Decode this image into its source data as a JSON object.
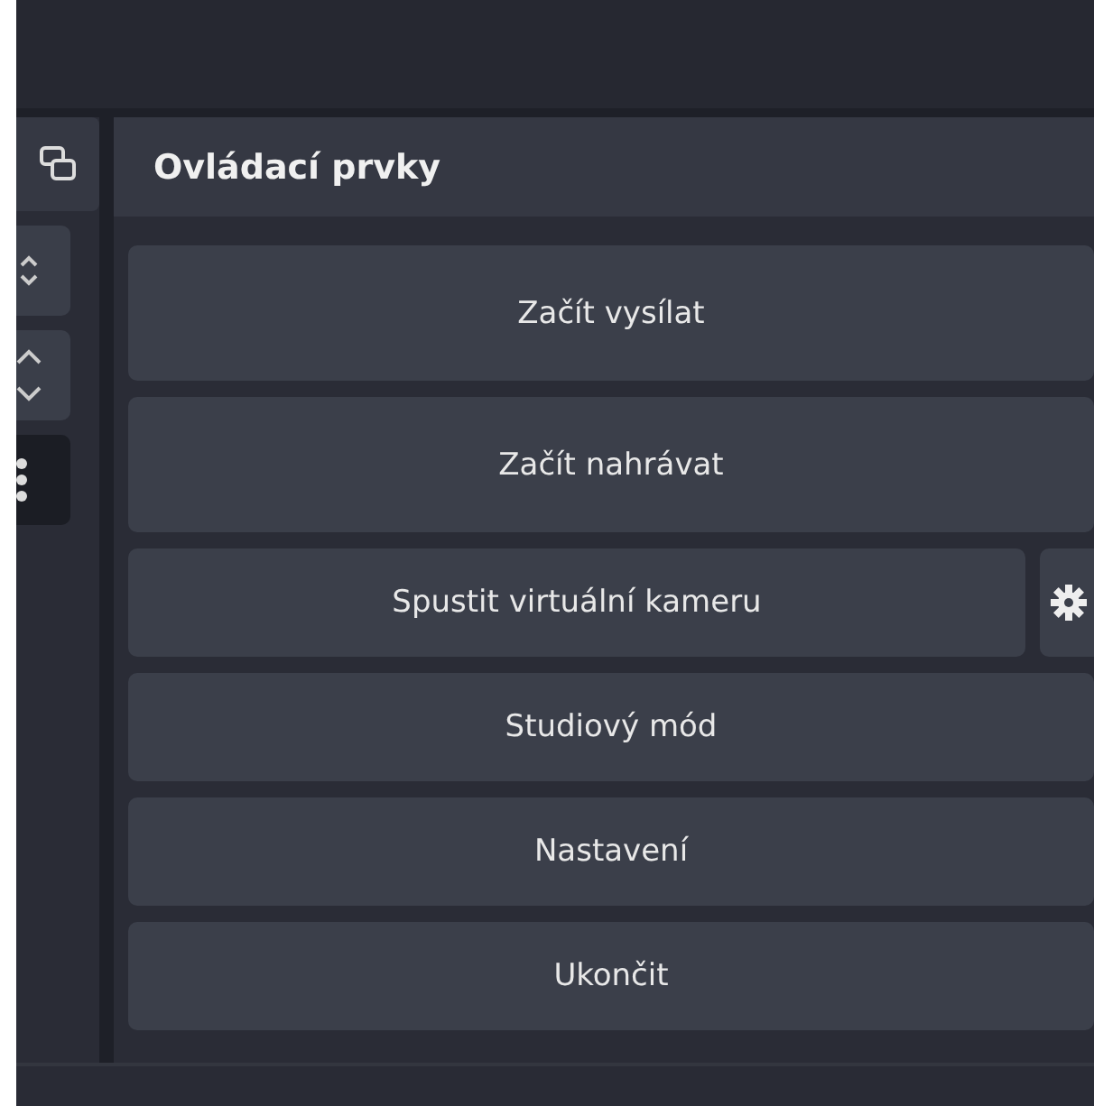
{
  "controls_dock": {
    "title": "Ovládací prvky",
    "buttons": [
      {
        "label": "Začít vysílat",
        "has_settings": false
      },
      {
        "label": "Začít nahrávat",
        "has_settings": false
      },
      {
        "label": "Spustit virtuální kameru",
        "has_settings": true
      },
      {
        "label": "Studiový mód",
        "has_settings": false
      },
      {
        "label": "Nastavení",
        "has_settings": false
      },
      {
        "label": "Ukončit",
        "has_settings": false
      }
    ]
  }
}
